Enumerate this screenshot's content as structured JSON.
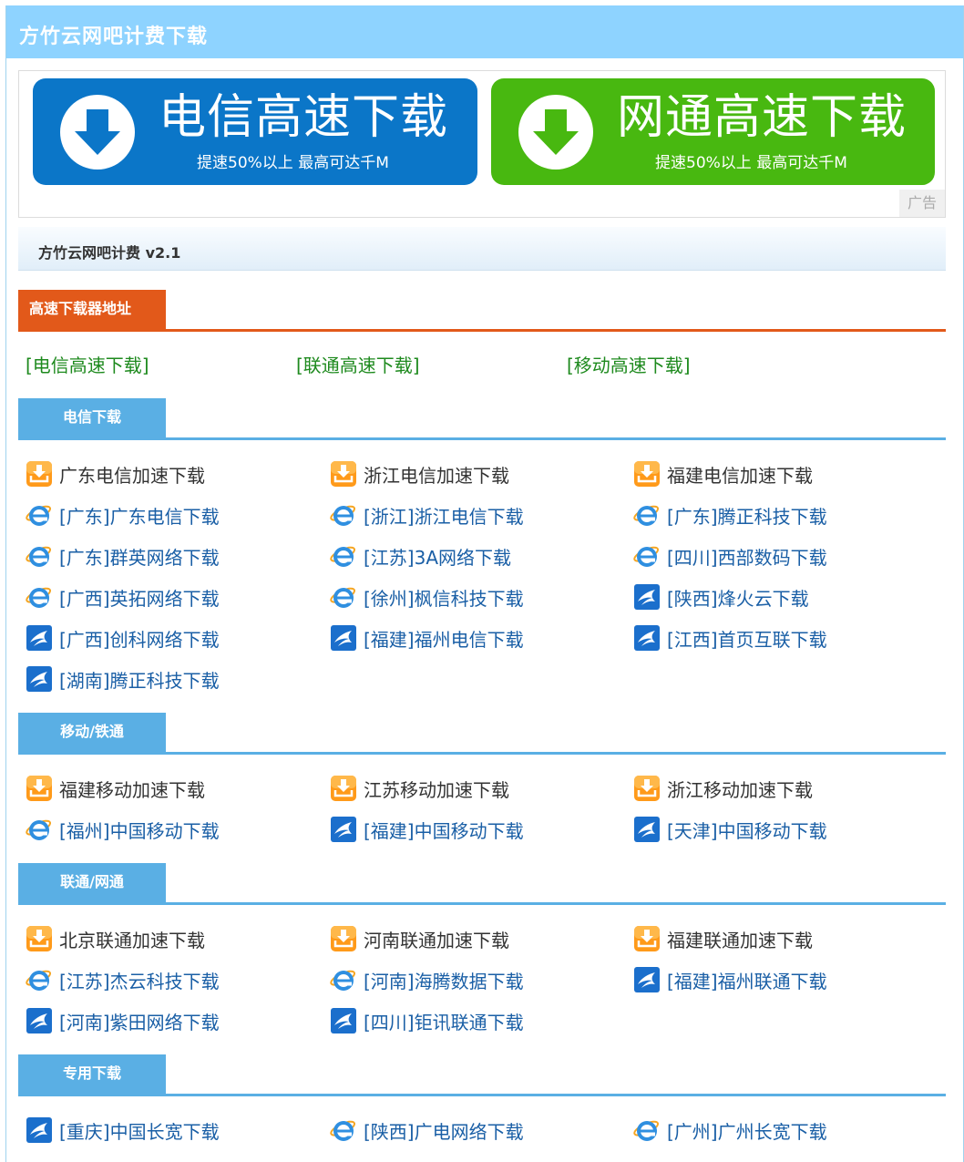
{
  "header": {
    "title": "方竹云网吧计费下载"
  },
  "ad": {
    "telecom": {
      "title": "电信高速下载",
      "subtitle": "提速50%以上 最高可达千M"
    },
    "unicom": {
      "title": "网通高速下载",
      "subtitle": "提速50%以上 最高可达千M"
    },
    "tag": "广告"
  },
  "subheader": {
    "title": "方竹云网吧计费 v2.1"
  },
  "downloader": {
    "heading": "高速下载器地址",
    "links": [
      "[电信高速下载]",
      "[联通高速下载]",
      "[移动高速下载]"
    ]
  },
  "colors": {
    "topbar": "#8ed3ff",
    "accent_blue": "#5aafe4",
    "accent_orange": "#e2591a",
    "link_green": "#1e8a1e",
    "link_blue": "#1a5fa6",
    "telecom_btn": "#0b76c8",
    "unicom_btn": "#48b810"
  },
  "sections": [
    {
      "heading": "电信下载",
      "items": [
        {
          "icon": "download-icon",
          "label": "广东电信加速下载"
        },
        {
          "icon": "download-icon",
          "label": "浙江电信加速下载"
        },
        {
          "icon": "download-icon",
          "label": "福建电信加速下载"
        },
        {
          "icon": "ie-icon",
          "label": "[广东]广东电信下载"
        },
        {
          "icon": "ie-icon",
          "label": "[浙江]浙江电信下载"
        },
        {
          "icon": "ie-icon",
          "label": "[广东]腾正科技下载"
        },
        {
          "icon": "ie-icon",
          "label": "[广东]群英网络下载"
        },
        {
          "icon": "ie-icon",
          "label": "[江苏]3A网络下载"
        },
        {
          "icon": "ie-icon",
          "label": "[四川]西部数码下载"
        },
        {
          "icon": "ie-icon",
          "label": "[广西]英拓网络下载"
        },
        {
          "icon": "ie-icon",
          "label": "[徐州]枫信科技下载"
        },
        {
          "icon": "swift-icon",
          "label": "[陕西]烽火云下载"
        },
        {
          "icon": "swift-icon",
          "label": "[广西]创科网络下载"
        },
        {
          "icon": "swift-icon",
          "label": "[福建]福州电信下载"
        },
        {
          "icon": "swift-icon",
          "label": "[江西]首页互联下载"
        },
        {
          "icon": "swift-icon",
          "label": "[湖南]腾正科技下载"
        }
      ]
    },
    {
      "heading": "移动/铁通",
      "items": [
        {
          "icon": "download-icon",
          "label": "福建移动加速下载"
        },
        {
          "icon": "download-icon",
          "label": "江苏移动加速下载"
        },
        {
          "icon": "download-icon",
          "label": "浙江移动加速下载"
        },
        {
          "icon": "ie-icon",
          "label": "[福州]中国移动下载"
        },
        {
          "icon": "swift-icon",
          "label": "[福建]中国移动下载"
        },
        {
          "icon": "swift-icon",
          "label": "[天津]中国移动下载"
        }
      ]
    },
    {
      "heading": "联通/网通",
      "items": [
        {
          "icon": "download-icon",
          "label": "北京联通加速下载"
        },
        {
          "icon": "download-icon",
          "label": "河南联通加速下载"
        },
        {
          "icon": "download-icon",
          "label": "福建联通加速下载"
        },
        {
          "icon": "ie-icon",
          "label": "[江苏]杰云科技下载"
        },
        {
          "icon": "ie-icon",
          "label": "[河南]海腾数据下载"
        },
        {
          "icon": "swift-icon",
          "label": "[福建]福州联通下载"
        },
        {
          "icon": "swift-icon",
          "label": "[河南]紫田网络下载"
        },
        {
          "icon": "swift-icon",
          "label": "[四川]钜讯联通下载"
        }
      ]
    },
    {
      "heading": "专用下载",
      "items": [
        {
          "icon": "swift-icon",
          "label": "[重庆]中国长宽下载"
        },
        {
          "icon": "ie-icon",
          "label": "[陕西]广电网络下载"
        },
        {
          "icon": "ie-icon",
          "label": "[广州]广州长宽下载"
        }
      ]
    }
  ]
}
